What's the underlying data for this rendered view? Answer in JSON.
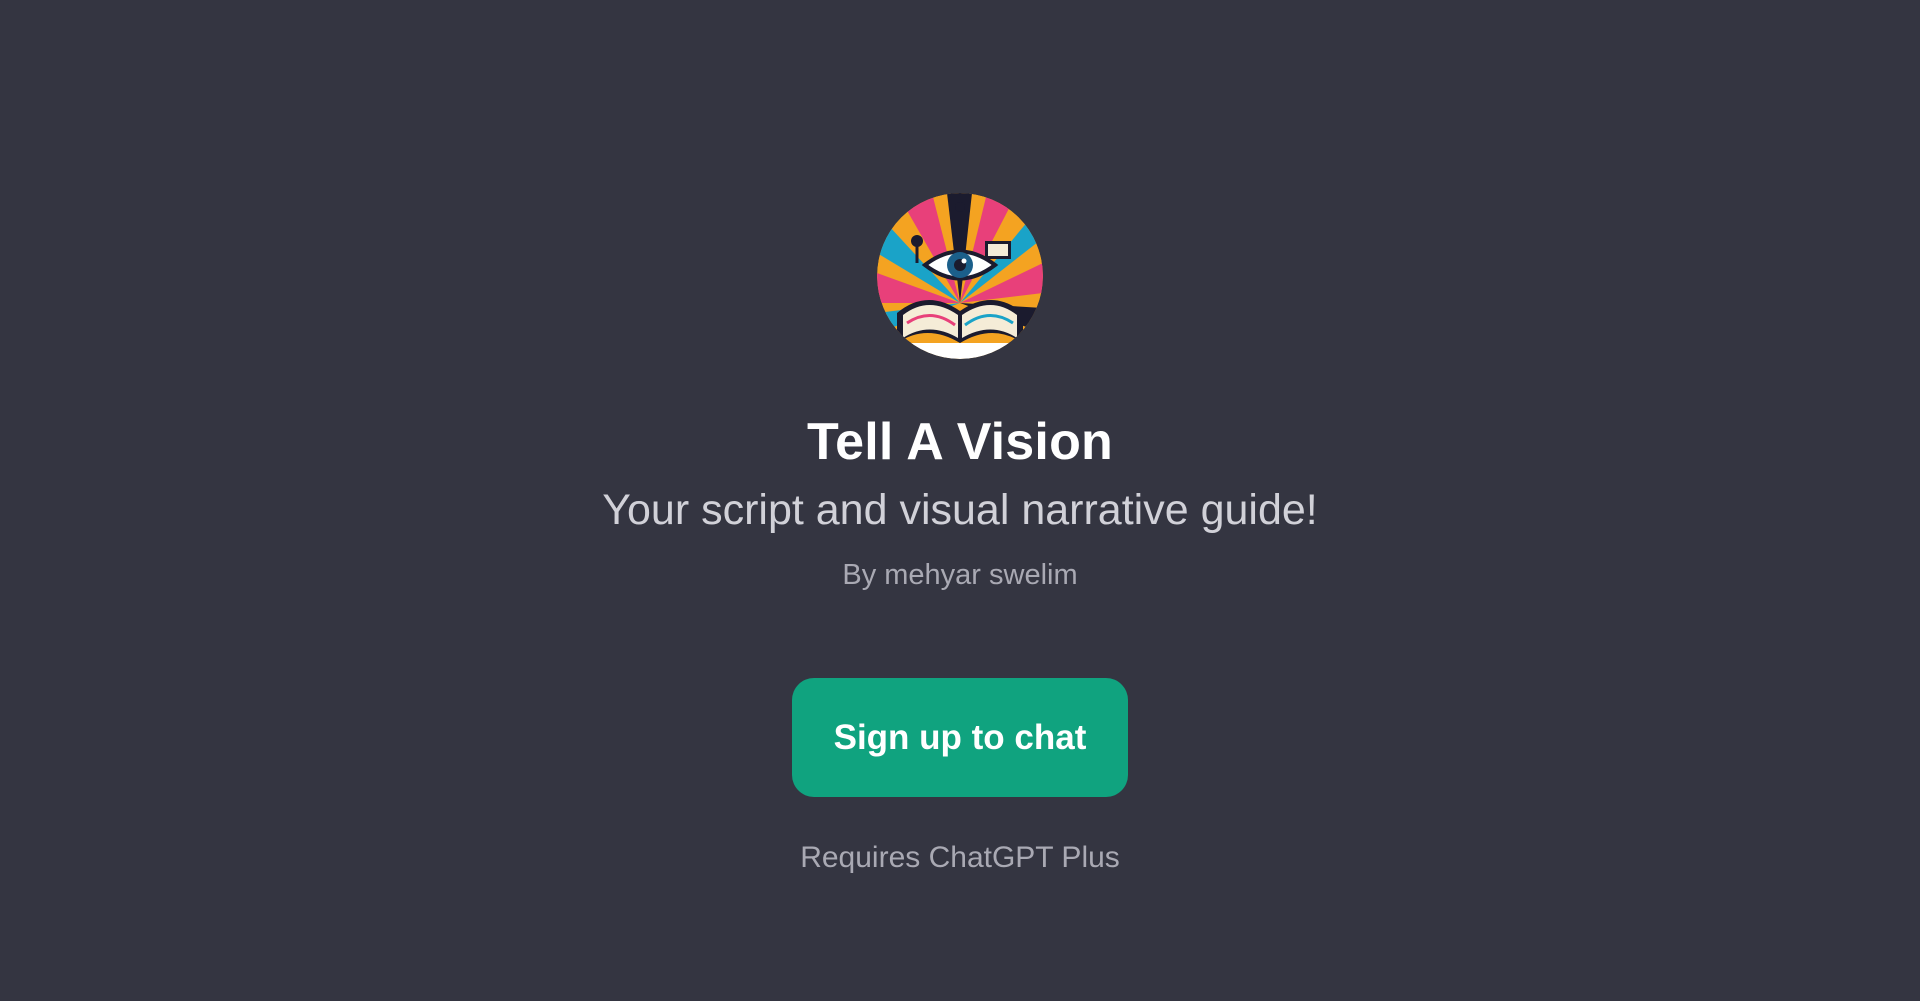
{
  "gpt": {
    "name": "Tell A Vision",
    "description": "Your script and visual narrative guide!",
    "author": "By mehyar swelim",
    "avatar_icon": "book-eye-logo"
  },
  "actions": {
    "signup_label": "Sign up to chat",
    "requirement_note": "Requires ChatGPT Plus"
  },
  "colors": {
    "background": "#343541",
    "accent": "#10a37f",
    "title_text": "#ffffff",
    "muted_text": "#a9a9b3"
  }
}
